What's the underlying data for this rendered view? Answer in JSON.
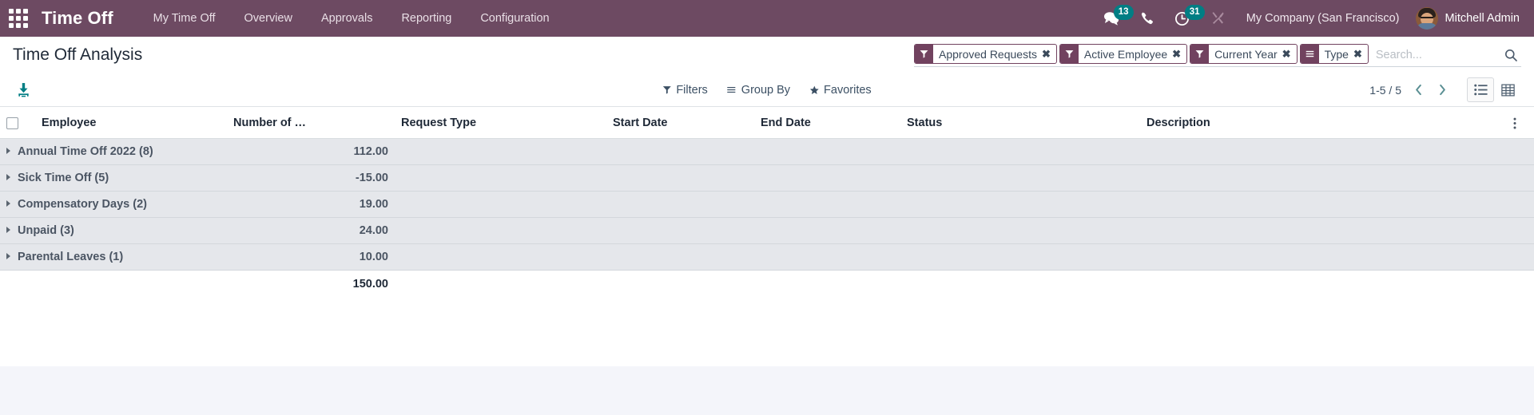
{
  "navbar": {
    "apps_icon": "apps-grid-icon",
    "brand": "Time Off",
    "menu": [
      {
        "label": "My Time Off"
      },
      {
        "label": "Overview"
      },
      {
        "label": "Approvals"
      },
      {
        "label": "Reporting"
      },
      {
        "label": "Configuration"
      }
    ],
    "systray": {
      "messages": {
        "icon": "comments-icon",
        "count": "13"
      },
      "phone": {
        "icon": "phone-icon",
        "count": ""
      },
      "activities": {
        "icon": "clock-icon",
        "count": "31"
      },
      "debug": {
        "icon": "wrench-screwdriver-icon",
        "count": ""
      }
    },
    "company": "My Company (San Francisco)",
    "user": "Mitchell Admin",
    "avatar": "user-avatar",
    "accent_badge_color": "#017e84",
    "bar_color": "#6d4a62"
  },
  "control_panel": {
    "title": "Time Off Analysis",
    "export_icon": "download-icon",
    "search": {
      "placeholder": "Search...",
      "value": "",
      "search_icon": "search-icon",
      "facets": [
        {
          "icon": "filter-icon",
          "label": "Approved Requests",
          "remove": "✖"
        },
        {
          "icon": "filter-icon",
          "label": "Active Employee",
          "remove": "✖"
        },
        {
          "icon": "filter-icon",
          "label": "Current Year",
          "remove": "✖"
        },
        {
          "icon": "groupby-bars-icon",
          "label": "Type",
          "remove": "✖"
        }
      ]
    },
    "dropdowns": [
      {
        "icon": "filter-icon",
        "label": "Filters"
      },
      {
        "icon": "groupby-bars-icon",
        "label": "Group By"
      },
      {
        "icon": "star-icon",
        "label": "Favorites"
      }
    ],
    "pager": {
      "range": "1-5 / 5",
      "prev_icon": "chevron-left-icon",
      "next_icon": "chevron-right-icon"
    },
    "views": [
      {
        "icon": "list-view-icon",
        "name": "list",
        "active": true
      },
      {
        "icon": "pivot-view-icon",
        "name": "pivot",
        "active": false
      }
    ]
  },
  "list": {
    "select_all_checkbox": false,
    "columns": [
      {
        "key": "employee",
        "label": "Employee",
        "align": "left"
      },
      {
        "key": "number_of_days",
        "label": "Number of …",
        "align": "right"
      },
      {
        "key": "request_type",
        "label": "Request Type",
        "align": "left"
      },
      {
        "key": "start_date",
        "label": "Start Date",
        "align": "left"
      },
      {
        "key": "end_date",
        "label": "End Date",
        "align": "left"
      },
      {
        "key": "status",
        "label": "Status",
        "align": "left"
      },
      {
        "key": "description",
        "label": "Description",
        "align": "left"
      }
    ],
    "optional_columns_icon": "vertical-dots-icon",
    "groups": [
      {
        "label": "Annual Time Off 2022 (8)",
        "value": "112.00"
      },
      {
        "label": "Sick Time Off (5)",
        "value": "-15.00"
      },
      {
        "label": "Compensatory Days (2)",
        "value": "19.00"
      },
      {
        "label": "Unpaid (3)",
        "value": "24.00"
      },
      {
        "label": "Parental Leaves (1)",
        "value": "10.00"
      }
    ],
    "total": {
      "label": "",
      "value": "150.00"
    }
  }
}
